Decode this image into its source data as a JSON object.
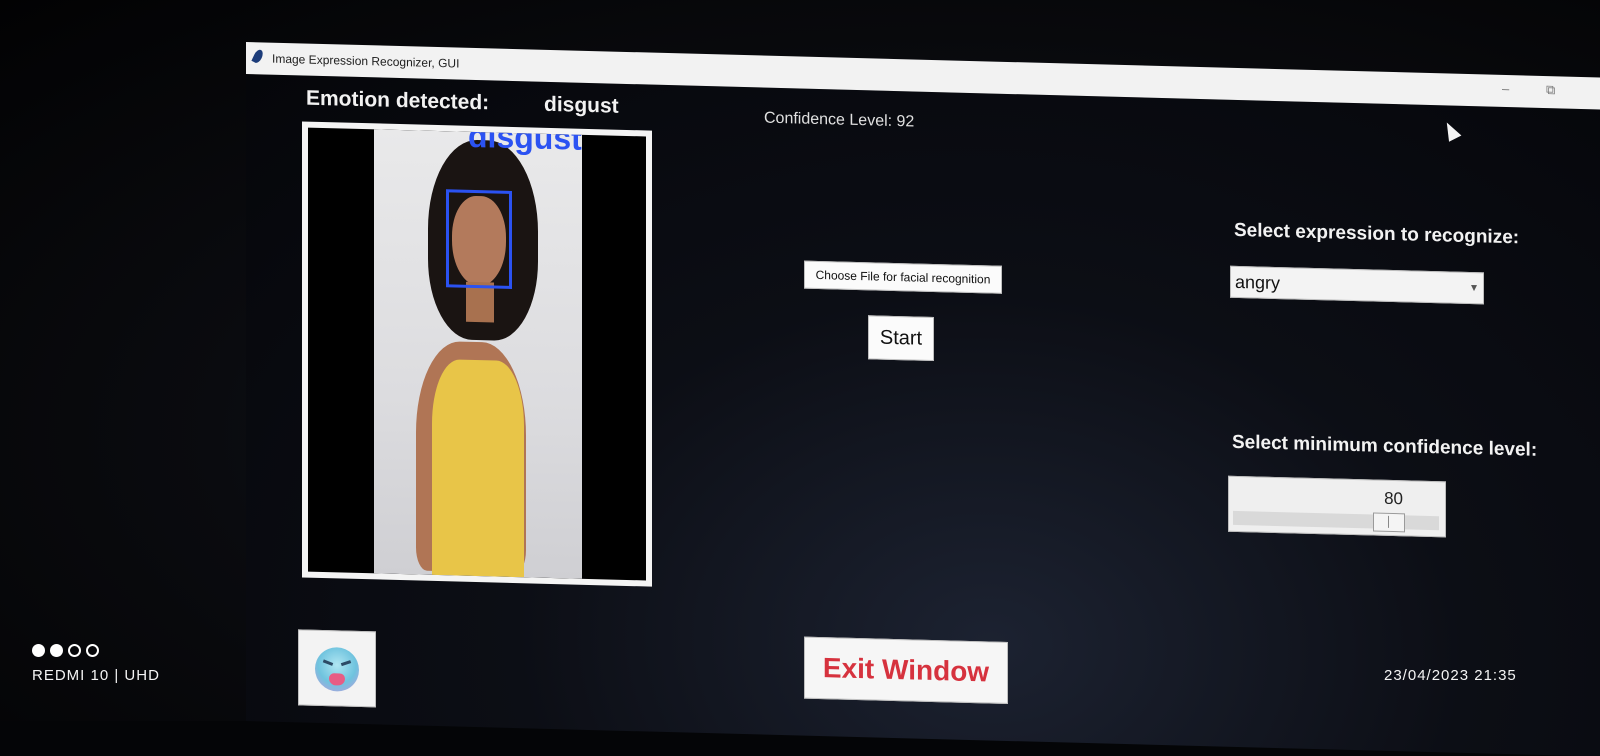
{
  "window": {
    "title": "Image Expression Recognizer, GUI",
    "minimize_glyph": "–",
    "restore_glyph": "⧉"
  },
  "main": {
    "emotion_label": "Emotion detected:",
    "emotion_value": "disgust",
    "confidence_text": "Confidence Level: 92",
    "image_overlay_label": "disgust",
    "choose_file_label": "Choose File for facial recognition",
    "start_label": "Start",
    "exit_label": "Exit Window",
    "emoji_icon": "disgust-emoji-icon"
  },
  "settings": {
    "expression_label": "Select expression to recognize:",
    "expression_selected": "angry",
    "confidence_label": "Select minimum confidence level:",
    "confidence_value": "80"
  },
  "photo_overlay": {
    "device": "REDMI 10 | UHD",
    "datetime": "23/04/2023   21:35"
  },
  "colors": {
    "accent_blue": "#2b52f2",
    "exit_red": "#d6323e",
    "window_bg": "#0c0e15"
  }
}
